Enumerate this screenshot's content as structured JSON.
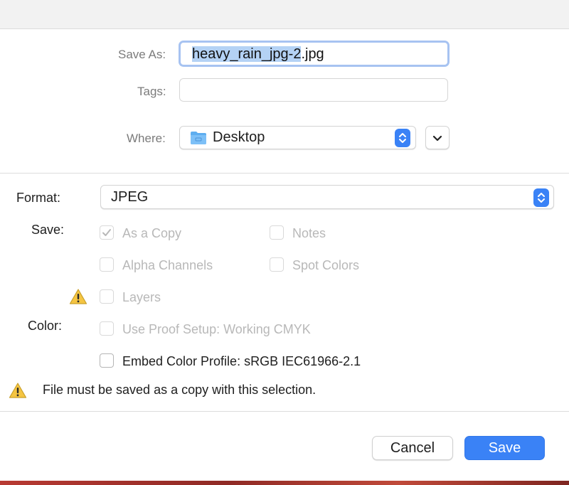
{
  "dialog": {
    "save_as_label": "Save As:",
    "filename_selected": "heavy_rain_jpg-2",
    "filename_ext": ".jpg",
    "tags_label": "Tags:",
    "tags_value": "",
    "where_label": "Where:",
    "where_value": "Desktop",
    "where_icon": "folder-icon"
  },
  "options": {
    "format_label": "Format:",
    "format_value": "JPEG",
    "save_label": "Save:",
    "color_label": "Color:",
    "checkboxes": {
      "as_a_copy": {
        "label": "As a Copy",
        "checked": true,
        "enabled": false
      },
      "notes": {
        "label": "Notes",
        "checked": false,
        "enabled": false
      },
      "alpha_channels": {
        "label": "Alpha Channels",
        "checked": false,
        "enabled": false
      },
      "spot_colors": {
        "label": "Spot Colors",
        "checked": false,
        "enabled": false
      },
      "layers": {
        "label": "Layers",
        "checked": false,
        "enabled": false
      },
      "use_proof_setup": {
        "label": "Use Proof Setup:  Working CMYK",
        "checked": false,
        "enabled": false
      },
      "embed_color_profile": {
        "label": "Embed Color Profile:  sRGB IEC61966-2.1",
        "checked": false,
        "enabled": true
      }
    },
    "warning_message": "File must be saved as a copy with this selection."
  },
  "buttons": {
    "cancel": "Cancel",
    "save": "Save"
  },
  "colors": {
    "accent": "#3a82f6",
    "warning": "#f5c542"
  }
}
